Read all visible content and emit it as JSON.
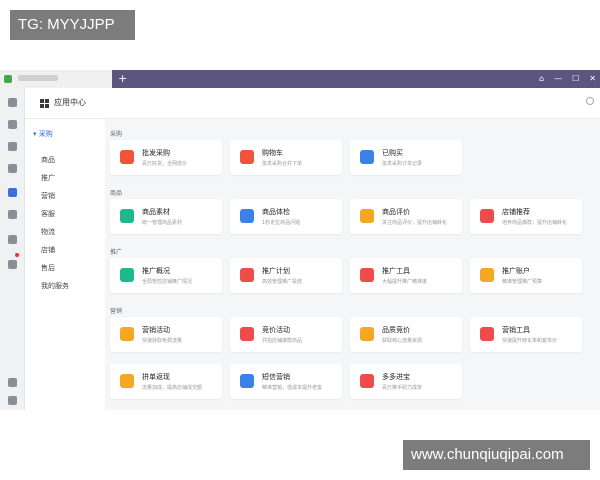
{
  "watermarks": {
    "top": "TG: MYYJJPP",
    "bottom": "www.chunqiuqipai.com"
  },
  "titlebar": {
    "new_tab": "+"
  },
  "header": {
    "title": "应用中心"
  },
  "subnav": {
    "category": "▾ 采购",
    "items": [
      "商品",
      "推广",
      "营销",
      "客服",
      "物流",
      "店铺",
      "售后",
      "我的服务"
    ]
  },
  "sections": [
    {
      "title": "采购",
      "cards": [
        {
          "title": "批发采购",
          "sub": "百万好货，全网低价",
          "icon": "wholesale-icon",
          "color": "#f0553c"
        },
        {
          "title": "购物车",
          "sub": "批发采购合并下单",
          "icon": "cart-icon",
          "color": "#f0553c"
        },
        {
          "title": "已购买",
          "sub": "批发采购订单记录",
          "icon": "order-doc-icon",
          "color": "#3b82e8"
        }
      ]
    },
    {
      "title": "商品",
      "cards": [
        {
          "title": "商品素材",
          "sub": "统一管理商品素材",
          "icon": "material-icon",
          "color": "#1fb88c"
        },
        {
          "title": "商品体检",
          "sub": "1秒定位商品问题",
          "icon": "checkup-icon",
          "color": "#3b82e8"
        },
        {
          "title": "商品评价",
          "sub": "关注商品评价，提升店铺转化",
          "icon": "review-icon",
          "color": "#f5a623"
        },
        {
          "title": "店铺推荐",
          "sub": "培养商品爆款，提升店铺转化",
          "icon": "thumbs-up-icon",
          "color": "#ef4b4b"
        }
      ]
    },
    {
      "title": "推广",
      "cards": [
        {
          "title": "推广概况",
          "sub": "全局管控店铺推广情况",
          "icon": "overview-icon",
          "color": "#1fb88c"
        },
        {
          "title": "推广计划",
          "sub": "高效管理推广投放",
          "icon": "plan-icon",
          "color": "#ef4b4b"
        },
        {
          "title": "推广工具",
          "sub": "大幅提升推广精准度",
          "icon": "megaphone-icon",
          "color": "#ef4b4b"
        },
        {
          "title": "推广账户",
          "sub": "精准管理推广预算",
          "icon": "wallet-icon",
          "color": "#f5a623"
        }
      ]
    },
    {
      "title": "营销",
      "cards": [
        {
          "title": "营销活动",
          "sub": "快速获取免费流量",
          "icon": "gift-icon",
          "color": "#f5a623"
        },
        {
          "title": "竞价活动",
          "sub": "共拍店铺爆款商品",
          "icon": "bid-icon",
          "color": "#ef4b4b"
        },
        {
          "title": "品质竞价",
          "sub": "获取核心流量资源",
          "icon": "trophy-icon",
          "color": "#f5a623"
        },
        {
          "title": "营销工具",
          "sub": "快速提升转化率和客单价",
          "icon": "flame-icon",
          "color": "#ef4b4b"
        },
        {
          "title": "拼单返现",
          "sub": "流量加成，提高店铺成交额",
          "icon": "coin-icon",
          "color": "#f5a623"
        },
        {
          "title": "短信营销",
          "sub": "精准营销，低成本提升老客",
          "icon": "sms-icon",
          "color": "#3b82e8"
        },
        {
          "title": "多多进宝",
          "sub": "百万推手助力成单",
          "icon": "treasure-icon",
          "color": "#ef4b4b"
        }
      ]
    }
  ]
}
